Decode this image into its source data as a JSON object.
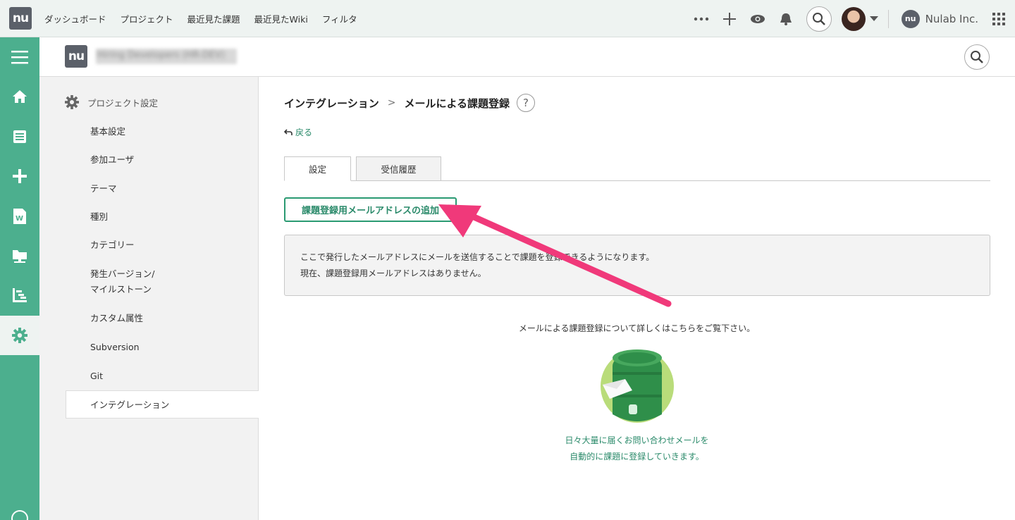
{
  "topbar": {
    "logo_text": "nu",
    "nav": [
      "ダッシュボード",
      "プロジェクト",
      "最近見た課題",
      "最近見たWiki",
      "フィルタ"
    ],
    "org_logo_text": "nu",
    "org_name": "Nulab Inc."
  },
  "project": {
    "logo_text": "nu",
    "name": "Hiring Developers (HR-DEV)"
  },
  "settings_sidebar": {
    "title": "プロジェクト設定",
    "items": [
      "基本設定",
      "参加ユーザ",
      "テーマ",
      "種別",
      "カテゴリー",
      "発生バージョン/",
      "マイルストーン",
      "カスタム属性",
      "Subversion",
      "Git",
      "インテグレーション"
    ]
  },
  "main": {
    "breadcrumb": [
      "インテグレーション",
      "メールによる課題登録"
    ],
    "breadcrumb_sep": ">",
    "help": "?",
    "back_label": "戻る",
    "tabs": [
      "設定",
      "受信履歴"
    ],
    "add_button": "課題登録用メールアドレスの追加",
    "info_lines": [
      "ここで発行したメールアドレスにメールを送信することで課題を登録できるようになります。",
      "現在、課題登録用メールアドレスはありません。"
    ],
    "more_info": "メールによる課題登録について詳しくはこちらをご覧下さい。",
    "promo_lines": [
      "日々大量に届くお問い合わせメールを",
      "自動的に課題に登録していきます。"
    ]
  },
  "colors": {
    "accent": "#4caf8e",
    "link": "#2a8a6a",
    "annotation_arrow": "#f0397a"
  }
}
